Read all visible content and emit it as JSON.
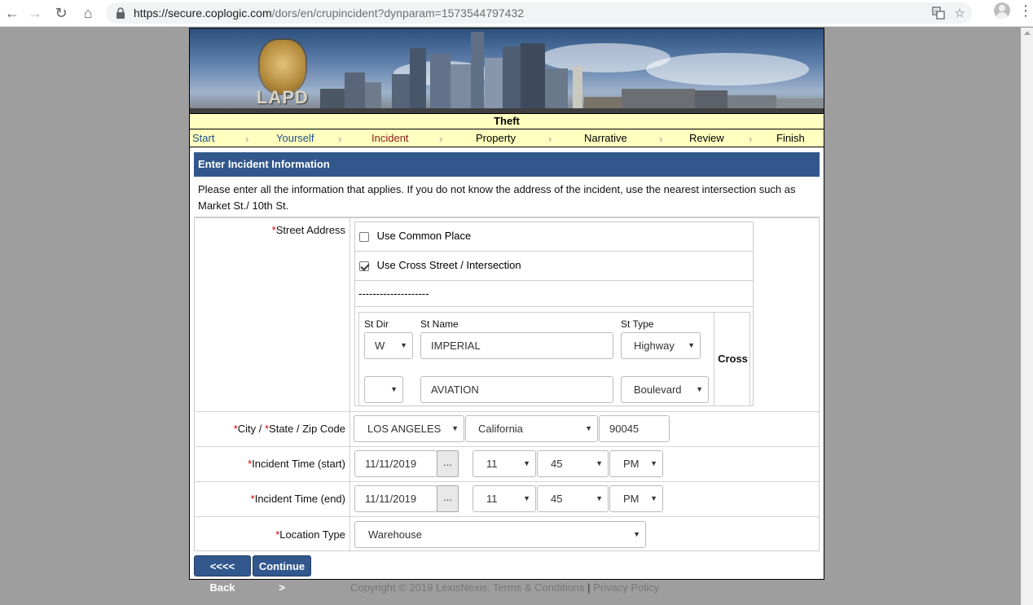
{
  "browser": {
    "url_host": "https://secure.coplogic.com",
    "url_path": "/dors/en/crupincident?dynparam=1573544797432",
    "icons": [
      "back-icon",
      "forward-icon",
      "reload-icon",
      "home-icon",
      "lock-icon",
      "translate-icon",
      "star-icon",
      "avatar-icon",
      "menu-icon"
    ]
  },
  "banner": {
    "logo_text": "LAPD"
  },
  "title": "Theft",
  "steps": [
    "Start",
    "Yourself",
    "Incident",
    "Property",
    "Narrative",
    "Review",
    "Finish"
  ],
  "section_title": "Enter Incident Information",
  "intro": "Please enter all the information that applies. If you do not know the address of the incident, use the nearest intersection such as Market St./ 10th St.",
  "street_address": {
    "label": "Street Address",
    "use_common_place": "Use Common Place",
    "use_common_place_checked": false,
    "use_cross_street": "Use Cross Street / Intersection",
    "use_cross_street_checked": true,
    "divider": "--------------------",
    "col_dir": "St Dir",
    "col_name": "St Name",
    "col_type": "St Type",
    "cross_label": "Cross",
    "street1": {
      "dir": "W",
      "name": "IMPERIAL",
      "type": "Highway"
    },
    "street2": {
      "dir": "",
      "name": "AVIATION",
      "type": "Boulevard"
    }
  },
  "city_state_zip": {
    "label_city": "City",
    "label_sep1": " / ",
    "label_state": "State",
    "label_zip": " / Zip Code",
    "city": "LOS ANGELES",
    "state": "California",
    "zip": "90045"
  },
  "incident_start": {
    "label": "Incident Time (start)",
    "date": "11/11/2019",
    "button": "...",
    "hour": "11",
    "minute": "45",
    "ampm": "PM"
  },
  "incident_end": {
    "label": "Incident Time (end)",
    "date": "11/11/2019",
    "button": "...",
    "hour": "11",
    "minute": "45",
    "ampm": "PM"
  },
  "location_type": {
    "label": "Location Type",
    "value": "Warehouse"
  },
  "buttons": {
    "back": "<<<< Back",
    "continue": "Continue >"
  },
  "footer": {
    "copyright": "Copyright ©  2019 LexisNexis.",
    "terms": "Terms & Conditions",
    "sep": "|",
    "privacy": "Privacy Policy"
  },
  "required_mark": "*"
}
